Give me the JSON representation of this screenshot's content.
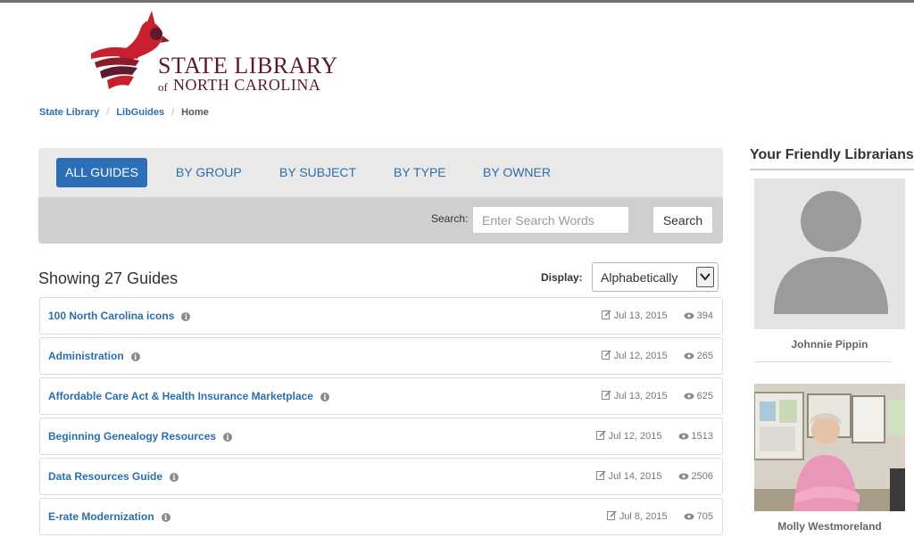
{
  "logo": {
    "line1": "STATE LIBRARY",
    "line2_prefix": "of",
    "line2": "NORTH CAROLINA",
    "icon": "cardinal-logo",
    "colors": {
      "red": "#c8202e",
      "maroon": "#5d1a2c"
    }
  },
  "breadcrumb": [
    "State Library",
    "LibGuides",
    "Home"
  ],
  "tabs": [
    "ALL GUIDES",
    "BY GROUP",
    "BY SUBJECT",
    "BY TYPE",
    "BY OWNER"
  ],
  "active_tab": "ALL GUIDES",
  "search": {
    "label": "Search:",
    "placeholder": "Enter Search Words",
    "value": "",
    "button": "Search"
  },
  "showing": "Showing 27 Guides",
  "display": {
    "label": "Display:",
    "value": "Alphabetically"
  },
  "guides": [
    {
      "title": "100 North Carolina icons",
      "date": "Jul 13, 2015",
      "views": "394"
    },
    {
      "title": "Administration",
      "date": "Jul 12, 2015",
      "views": "265"
    },
    {
      "title": "Affordable Care Act & Health Insurance Marketplace",
      "date": "Jul 13, 2015",
      "views": "625"
    },
    {
      "title": "Beginning Genealogy Resources",
      "date": "Jul 12, 2015",
      "views": "1513"
    },
    {
      "title": "Data Resources Guide",
      "date": "Jul 14, 2015",
      "views": "2506"
    },
    {
      "title": "E-rate Modernization",
      "date": "Jul 8, 2015",
      "views": "705"
    }
  ],
  "sidebar": {
    "title": "Your Friendly Librarians",
    "librarians": [
      {
        "name": "Johnnie Pippin",
        "photo": "default-avatar-icon"
      },
      {
        "name": "Molly Westmoreland",
        "photo": "librarian-photo"
      }
    ]
  },
  "colors": {
    "accent": "#2b70b7",
    "link": "#2c6eaa",
    "panel_top": "#e9e9e9",
    "panel_bottom": "#cfcfcf"
  }
}
